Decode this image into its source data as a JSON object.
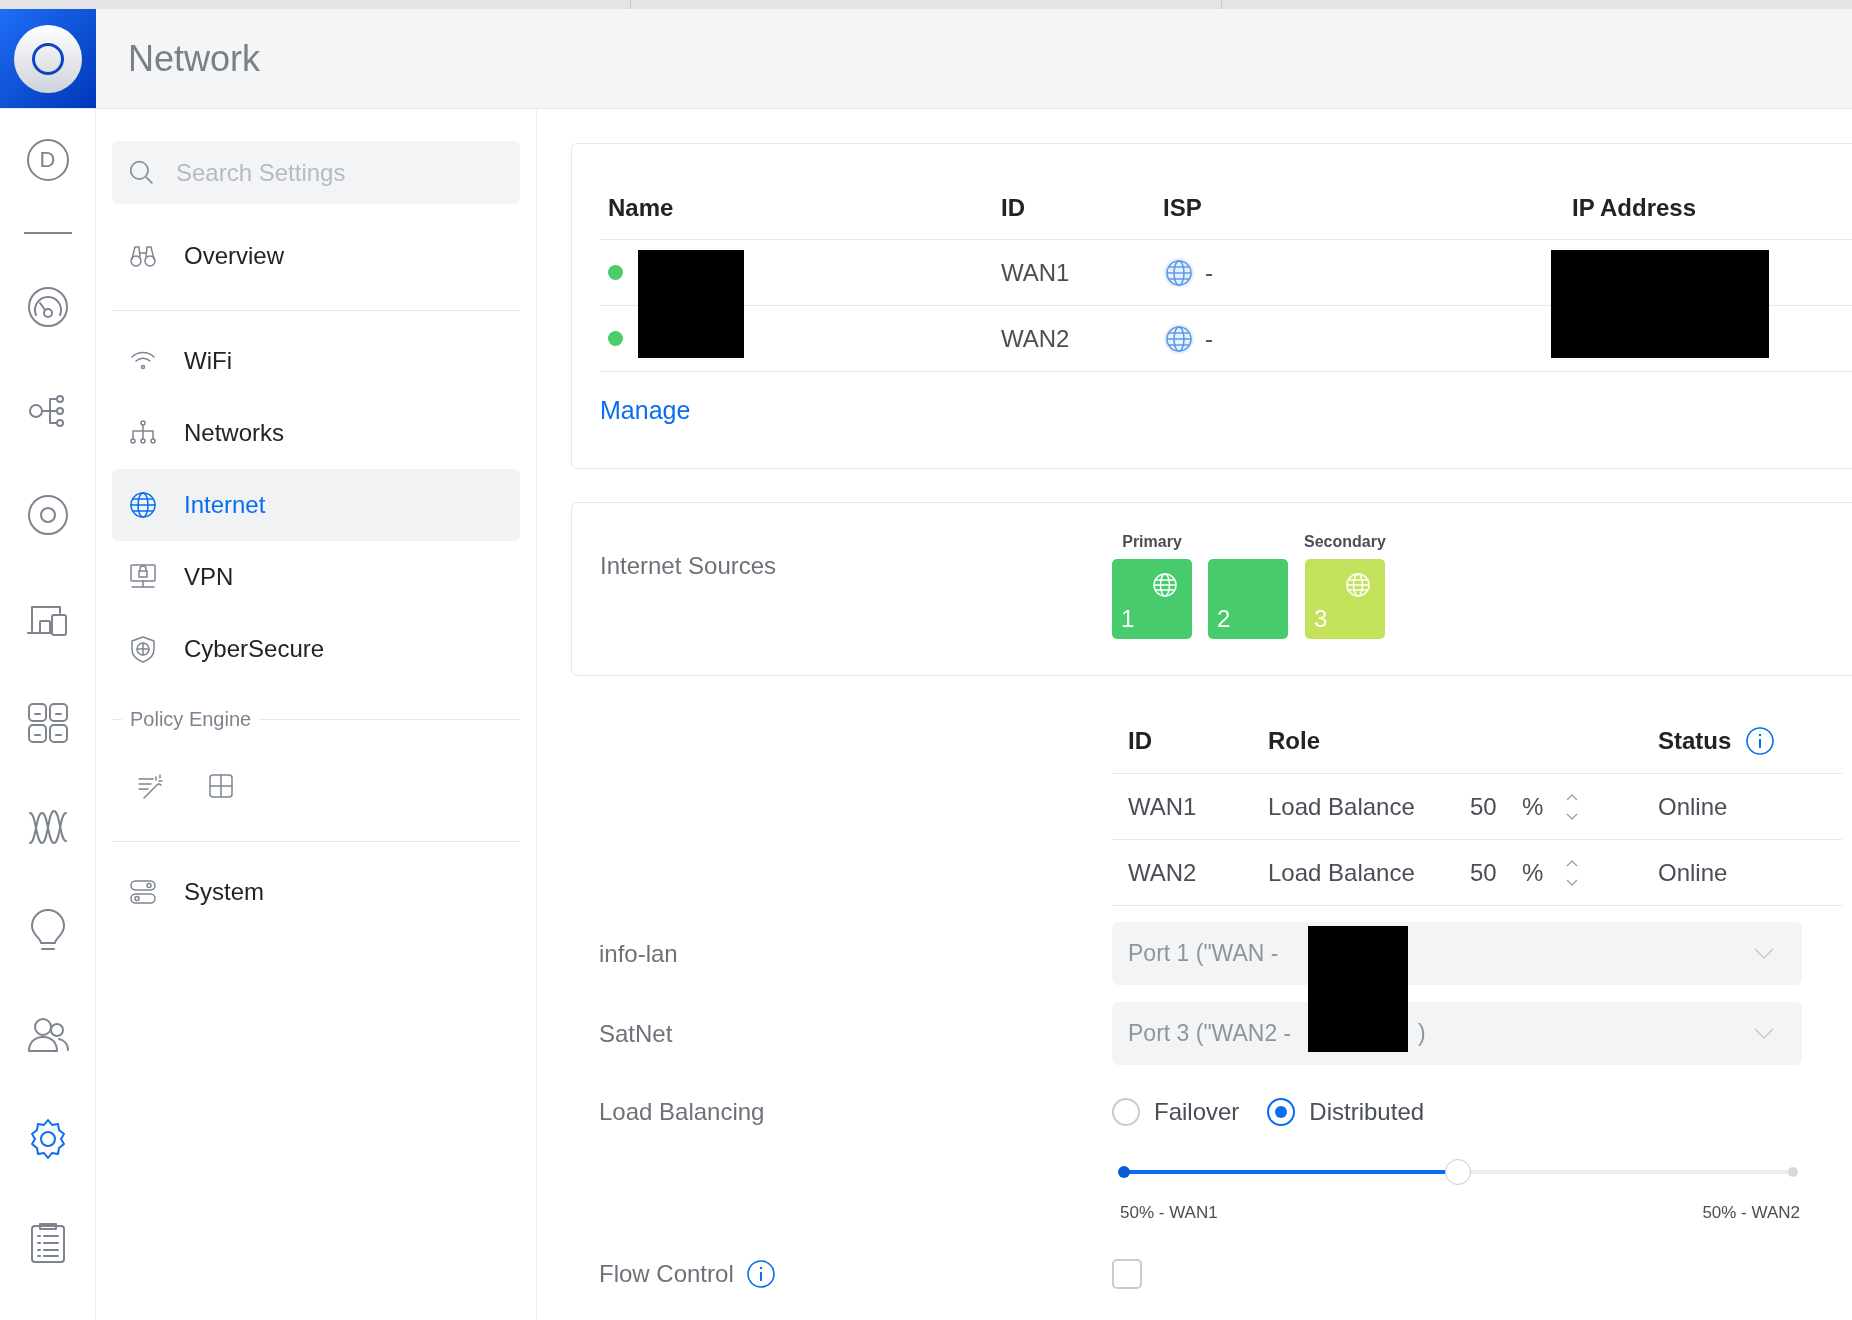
{
  "app": {
    "title": "Network"
  },
  "rail": {
    "avatar": "D",
    "items": [
      {
        "selected": false
      },
      {
        "selected": false
      },
      {
        "selected": false
      },
      {
        "selected": false
      },
      {
        "selected": false
      },
      {
        "selected": false
      },
      {
        "selected": false
      },
      {
        "selected": false
      },
      {
        "selected": true
      },
      {
        "selected": false
      }
    ]
  },
  "sidebar": {
    "search": {
      "placeholder": "Search Settings"
    },
    "sections": [
      {
        "kind": "links",
        "items": [
          {
            "label": "Overview",
            "selected": false
          }
        ]
      },
      {
        "kind": "links",
        "items": [
          {
            "label": "WiFi",
            "selected": false
          },
          {
            "label": "Networks",
            "selected": false
          },
          {
            "label": "Internet",
            "selected": true
          },
          {
            "label": "VPN",
            "selected": false
          },
          {
            "label": "CyberSecure",
            "selected": false
          }
        ]
      },
      {
        "kind": "tools",
        "title": "Policy Engine",
        "items": [
          {
            "selected": false
          },
          {
            "selected": false
          }
        ]
      },
      {
        "kind": "links",
        "items": [
          {
            "label": "System",
            "selected": false
          }
        ]
      }
    ]
  },
  "wan_table": {
    "columns": [
      "Name",
      "ID",
      "ISP",
      "IP Address"
    ],
    "rows": [
      {
        "color": "#4ccd6a",
        "id": "WAN1",
        "isp": "-"
      },
      {
        "color": "#4ccd6a",
        "id": "WAN2",
        "isp": "-"
      }
    ],
    "link": "Manage"
  },
  "sources": {
    "label": "Internet Sources",
    "tiles": [
      {
        "caption": "Primary",
        "number": "1",
        "color": "#47cb6c",
        "globe": true
      },
      {
        "number": "2",
        "color": "#47cb6c",
        "globe": false
      },
      {
        "caption": "Secondary",
        "number": "3",
        "color": "#c3e15b",
        "globe": true
      }
    ]
  },
  "roles_table": {
    "columns": [
      "ID",
      "Role",
      "Status"
    ],
    "rows": [
      {
        "id": "WAN1",
        "role": "Load Balance",
        "weight": "50",
        "unit": "%",
        "status": "Online"
      },
      {
        "id": "WAN2",
        "role": "Load Balance",
        "weight": "50",
        "unit": "%",
        "status": "Online"
      }
    ]
  },
  "ports": [
    {
      "label": "info-lan",
      "value": "Port 1 (\"WAN -",
      "disabled": true
    },
    {
      "label": "SatNet",
      "value": "Port 3 (\"WAN2 -",
      "value_end": ")",
      "disabled": true
    }
  ],
  "load_balancing": {
    "label": "Load Balancing",
    "options": [
      {
        "label": "Failover",
        "selected": false
      },
      {
        "label": "Distributed",
        "selected": true
      }
    ],
    "slider": {
      "level": 0.5,
      "left_label": "50% - WAN1",
      "right_label": "50% - WAN2"
    }
  },
  "flow_control": {
    "label": "Flow Control",
    "checked": false
  }
}
